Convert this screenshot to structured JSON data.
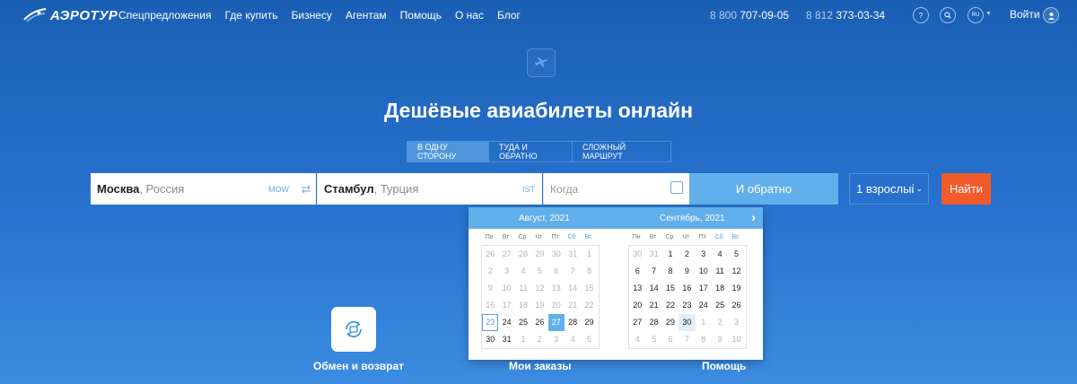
{
  "header": {
    "logo": "АЭРОТУР",
    "nav": [
      "Спецпредложения",
      "Где купить",
      "Бизнесу",
      "Агентам",
      "Помощь",
      "О нас",
      "Блог"
    ],
    "phone1": {
      "prefix": "8 800",
      "number": "707-09-05"
    },
    "phone2": {
      "prefix": "8 812",
      "number": "373-03-34"
    },
    "help_label": "?",
    "lang": "RU",
    "login": "Войти"
  },
  "hero": {
    "title": "Дешёвые авиабилеты онлайн",
    "tabs": [
      "В одну сторону",
      "Туда и обратно",
      "Сложный маршрут"
    ]
  },
  "search": {
    "from_city": "Москва",
    "from_country": ", Россия",
    "from_code": "MOW",
    "to_city": "Стамбул",
    "to_country": ", Турция",
    "to_code": "IST",
    "date_placeholder": "Когда",
    "return_label": "И обратно",
    "passengers": "1 взрослый",
    "find_label": "Найти"
  },
  "calendar": {
    "month1": "Август, 2021",
    "month2": "Сентябрь, 2021",
    "weekdays": [
      "Пн",
      "Вт",
      "Ср",
      "Чт",
      "Пт",
      "Сб",
      "Вс"
    ],
    "aug": [
      [
        26,
        27,
        28,
        29,
        30,
        31,
        1
      ],
      [
        2,
        3,
        4,
        5,
        6,
        7,
        8
      ],
      [
        9,
        10,
        11,
        12,
        13,
        14,
        15
      ],
      [
        16,
        17,
        18,
        19,
        20,
        21,
        22
      ],
      [
        23,
        24,
        25,
        26,
        27,
        28,
        29
      ],
      [
        30,
        31,
        1,
        2,
        3,
        4,
        5
      ]
    ],
    "sep": [
      [
        30,
        31,
        1,
        2,
        3,
        4,
        5
      ],
      [
        6,
        7,
        8,
        9,
        10,
        11,
        12
      ],
      [
        13,
        14,
        15,
        16,
        17,
        18,
        19
      ],
      [
        20,
        21,
        22,
        23,
        24,
        25,
        26
      ],
      [
        27,
        28,
        29,
        30,
        1,
        2,
        3
      ],
      [
        4,
        5,
        6,
        7,
        8,
        9,
        10
      ]
    ]
  },
  "services": [
    "Обмен и возврат",
    "Мои заказы",
    "Помощь"
  ]
}
